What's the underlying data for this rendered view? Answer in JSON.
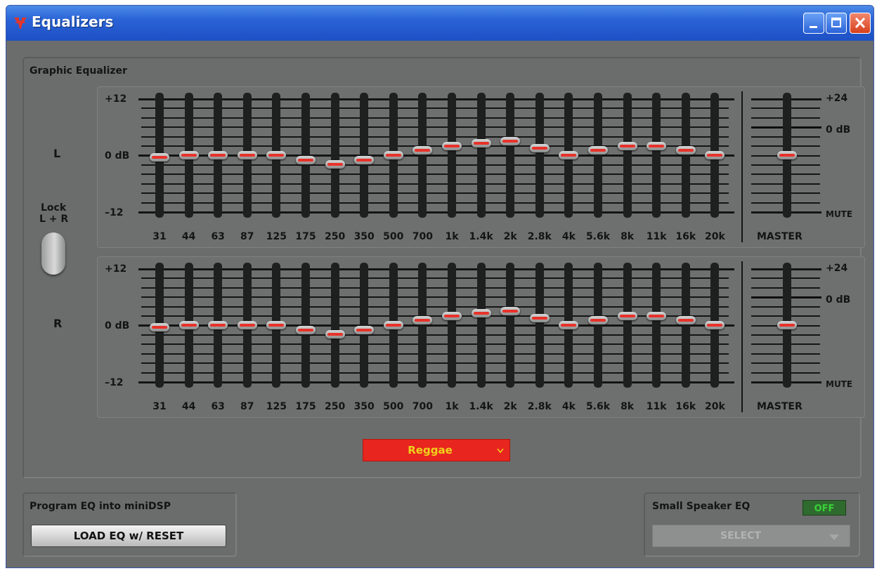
{
  "window": {
    "title": "Equalizers"
  },
  "graphic_eq": {
    "label": "Graphic Equalizer",
    "lock_label_line1": "Lock",
    "lock_label_line2": "L + R",
    "y_labels": {
      "top": "+12",
      "mid": "0 dB",
      "bottom": "–12"
    },
    "master_labels": {
      "top": "+24",
      "zero": "0 dB",
      "mute": "MUTE",
      "name": "MASTER"
    },
    "frequencies": [
      "31",
      "44",
      "63",
      "87",
      "125",
      "175",
      "250",
      "350",
      "500",
      "700",
      "1k",
      "1.4k",
      "2k",
      "2.8k",
      "4k",
      "5.6k",
      "8k",
      "11k",
      "16k",
      "20k"
    ],
    "channels": [
      {
        "name": "L",
        "gains_db": [
          -0.5,
          0,
          0,
          0,
          0,
          -1,
          -2,
          -1,
          0,
          1,
          2,
          2.5,
          3,
          1.5,
          0,
          1,
          2,
          2,
          1,
          0
        ],
        "master_db": 0
      },
      {
        "name": "R",
        "gains_db": [
          -0.5,
          0,
          0,
          0,
          0,
          -1,
          -2,
          -1,
          0,
          1,
          2,
          2.5,
          3,
          1.5,
          0,
          1,
          2,
          2,
          1,
          0
        ],
        "master_db": 0
      }
    ],
    "preset": {
      "value": "Reggae",
      "color": "#e8251e",
      "text_color": "#f0d21c"
    }
  },
  "program_eq": {
    "label": "Program EQ into miniDSP",
    "button_label": "LOAD EQ w/ RESET"
  },
  "small_speaker_eq": {
    "label": "Small Speaker EQ",
    "toggle": "OFF",
    "select_value": "SELECT"
  }
}
